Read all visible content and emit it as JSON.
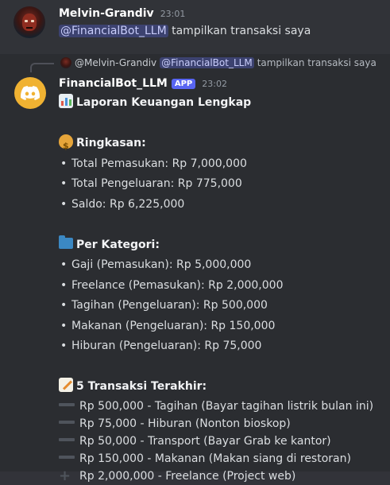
{
  "message_user": {
    "username": "Melvin-Grandiv",
    "time": "23:01",
    "mention": "@FinancialBot_LLM",
    "text": "tampilkan transaksi saya"
  },
  "message_bot": {
    "reply_to": {
      "username": "@Melvin-Grandiv",
      "mention": "@FinancialBot_LLM",
      "text": "tampilkan transaksi saya"
    },
    "botname": "FinancialBot_LLM",
    "tag": "APP",
    "time": "23:02",
    "title": "Laporan Keuangan Lengkap",
    "summary": {
      "heading": "Ringkasan:",
      "items": [
        "Total Pemasukan: Rp 7,000,000",
        "Total Pengeluaran: Rp 775,000",
        "Saldo: Rp 6,225,000"
      ]
    },
    "categories": {
      "heading": "Per Kategori:",
      "items": [
        "Gaji (Pemasukan): Rp 5,000,000",
        "Freelance (Pemasukan): Rp 2,000,000",
        "Tagihan (Pengeluaran): Rp 500,000",
        "Makanan (Pengeluaran): Rp 150,000",
        "Hiburan (Pengeluaran): Rp 75,000"
      ]
    },
    "transactions": {
      "heading": "5 Transaksi Terakhir:",
      "items": [
        "Rp 500,000 - Tagihan (Bayar tagihan listrik bulan ini)",
        "Rp 75,000 - Hiburan (Nonton bioskop)",
        "Rp 50,000 - Transport (Bayar Grab ke kantor)",
        "Rp 150,000 - Makanan (Makan siang di restoran)",
        "Rp 2,000,000 - Freelance (Project web)"
      ]
    }
  }
}
